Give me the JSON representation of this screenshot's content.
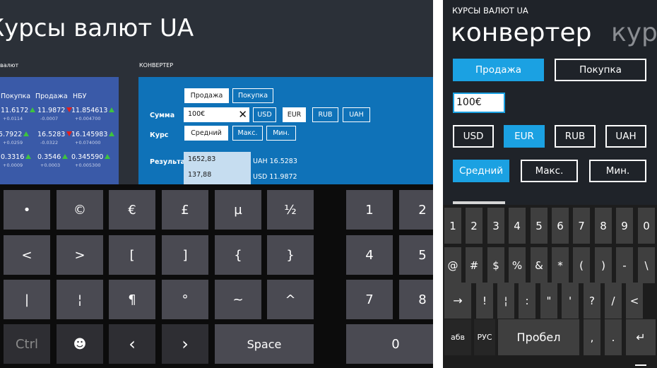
{
  "left": {
    "app_title": "Курсы валют UA",
    "rates_label": "валют",
    "converter_label": "КОНВЕРТЕР",
    "rates": {
      "headers": [
        "Покупка",
        "Продажа",
        "НБУ"
      ],
      "rows": [
        {
          "buy": "11.6172",
          "buy_d": "+0.0114",
          "sell": "11.9872",
          "sell_d": "-0.0007",
          "nbu": "11.854613",
          "nbu_d": "+0.004700"
        },
        {
          "buy": "15.7922",
          "buy_d": "+0.0259",
          "sell": "16.5283",
          "sell_d": "-0.0322",
          "nbu": "16.145983",
          "nbu_d": "+0.074000"
        },
        {
          "buy": "0.3316",
          "buy_d": "+0.0009",
          "sell": "0.3546",
          "sell_d": "+0.0003",
          "nbu": "0.345590",
          "nbu_d": "+0.005300"
        }
      ]
    },
    "converter": {
      "sell": "Продажа",
      "buy": "Покупка",
      "sum_label": "Сумма",
      "sum_value": "100€",
      "clear": "✕",
      "currencies": [
        "USD",
        "EUR",
        "RUB",
        "UAH"
      ],
      "rate_label": "Курс",
      "rates": [
        "Средний",
        "Макс.",
        "Мин."
      ],
      "result_label": "Результат",
      "results": [
        {
          "value": "1652,83",
          "text": "UAH  16.5283"
        },
        {
          "value": "137,88",
          "text": "USD  11.9872"
        }
      ]
    },
    "keyboard": {
      "rows": [
        [
          "•",
          "©",
          "€",
          "£",
          "µ",
          "½"
        ],
        [
          "<",
          ">",
          "[",
          "]",
          "{",
          "}"
        ],
        [
          "|",
          "¦",
          "¶",
          "°",
          "~",
          "^"
        ]
      ],
      "bottom": [
        "Ctrl",
        "☻",
        "‹",
        "›"
      ],
      "space": "Space",
      "numpad": [
        [
          "1",
          "2"
        ],
        [
          "4",
          "5"
        ],
        [
          "7",
          "8"
        ]
      ],
      "zero": "0"
    }
  },
  "right": {
    "app_title": "КУРСЫ ВАЛЮТ UA",
    "pivot_active": "конвертер",
    "pivot_next": "курс",
    "sell": "Продажа",
    "buy": "Покупка",
    "amount": "100€",
    "currencies": [
      "USD",
      "EUR",
      "RUB",
      "UAH"
    ],
    "rates": [
      "Средний",
      "Макс.",
      "Мин."
    ],
    "keyboard": {
      "row1": [
        "1",
        "2",
        "3",
        "4",
        "5",
        "6",
        "7",
        "8",
        "9",
        "0"
      ],
      "row2": [
        "@",
        "#",
        "$",
        "%",
        "&",
        "*",
        "(",
        ")",
        "-",
        "\\"
      ],
      "row3": [
        "→",
        "!",
        "¦",
        ":",
        "\"",
        "'",
        "?",
        "/",
        "<",
        "⌫"
      ],
      "row4": [
        "абв",
        "РУС",
        "Пробел",
        ",",
        ".",
        "↵"
      ]
    }
  },
  "colors": {
    "left_bg": "#2b3038",
    "rates_panel": "#3a5aa8",
    "converter_panel": "#0f72b8",
    "phone_accent": "#1ba1e2",
    "up": "#3ec43e",
    "down": "#e02020"
  }
}
